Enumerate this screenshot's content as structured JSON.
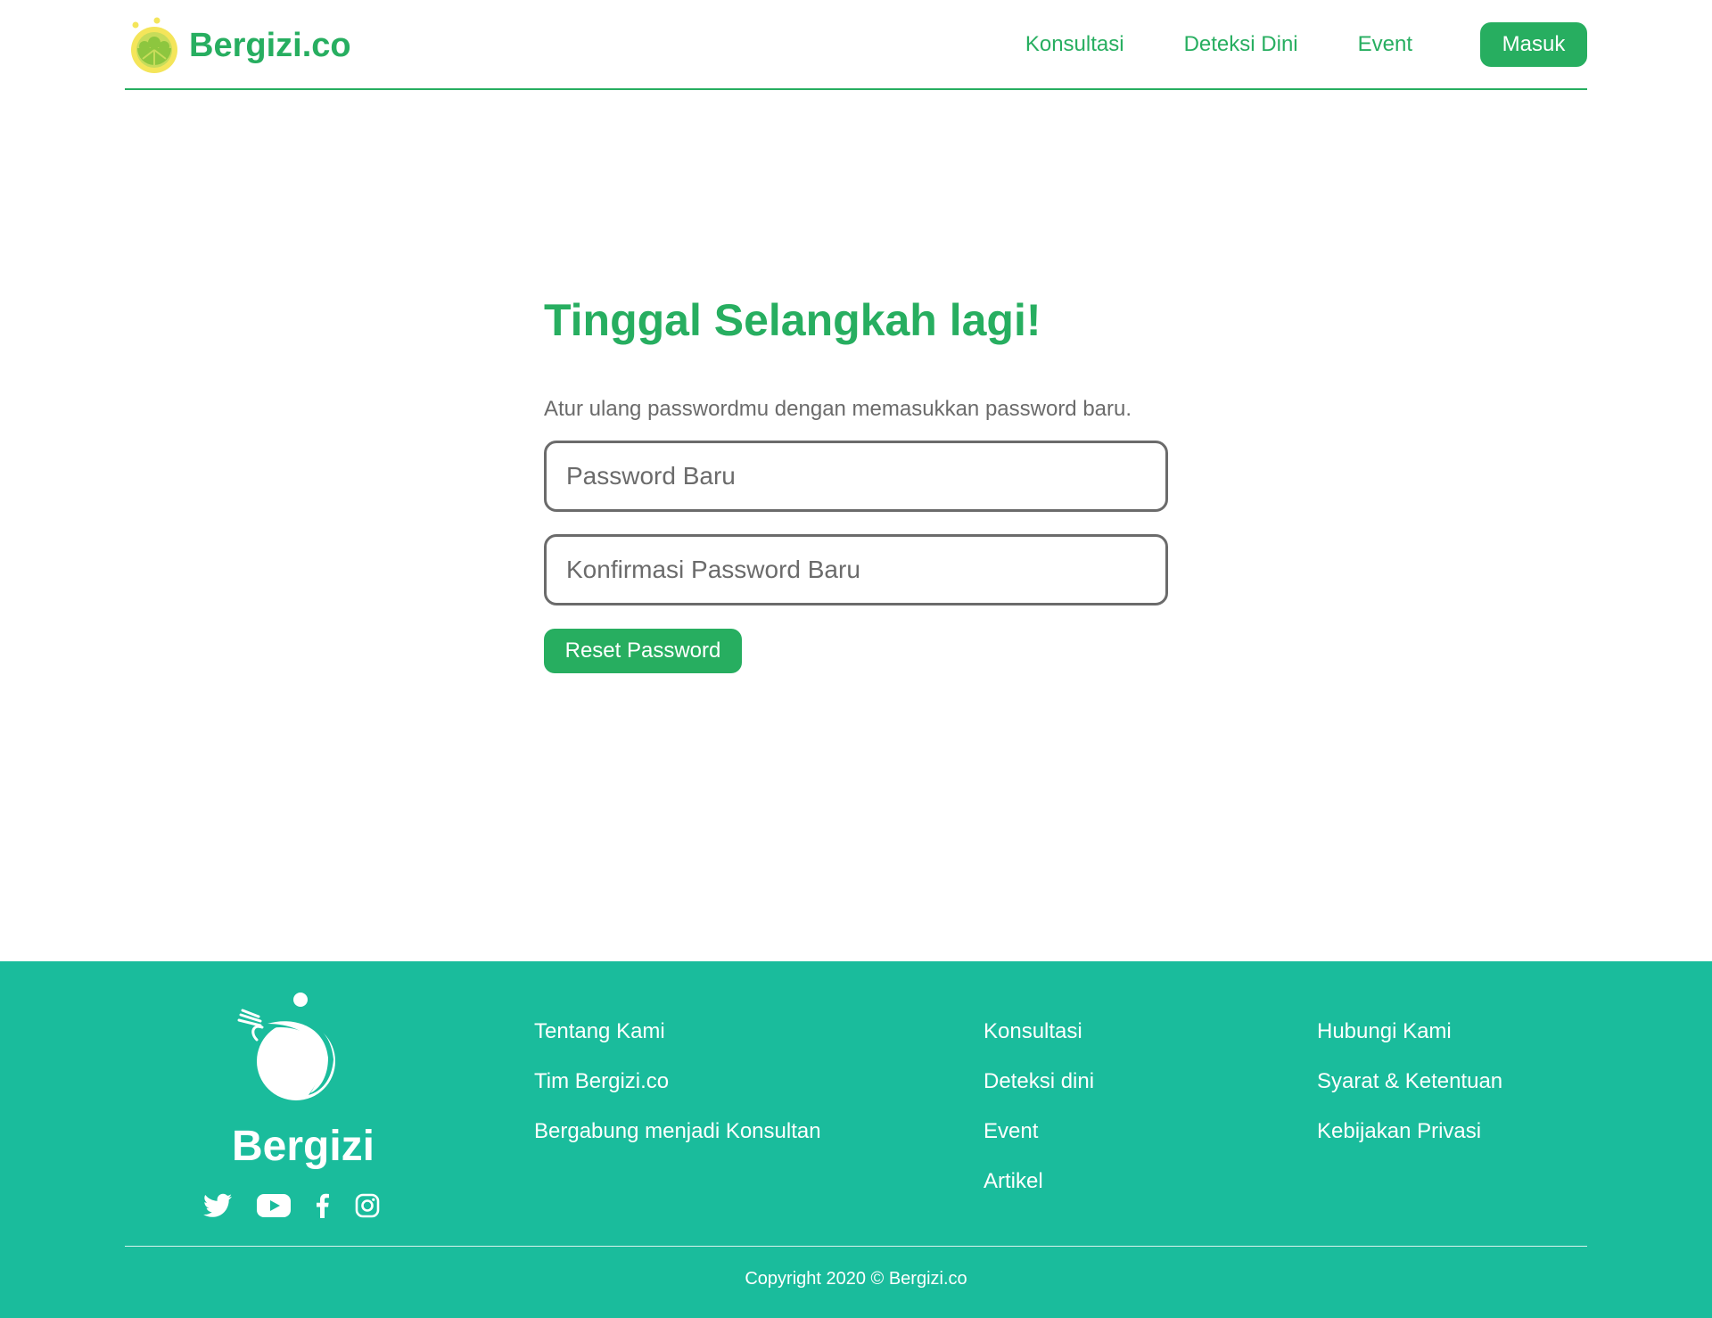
{
  "header": {
    "brand": "Bergizi.co",
    "nav": {
      "konsultasi": "Konsultasi",
      "deteksi": "Deteksi Dini",
      "event": "Event"
    },
    "login_label": "Masuk"
  },
  "main": {
    "title": "Tinggal Selangkah lagi!",
    "subtitle": "Atur ulang passwordmu dengan memasukkan password baru.",
    "new_password_placeholder": "Password Baru",
    "confirm_password_placeholder": "Konfirmasi Password Baru",
    "reset_label": "Reset Password"
  },
  "footer": {
    "brand": "Bergizi",
    "socials": [
      "twitter-icon",
      "youtube-icon",
      "facebook-icon",
      "instagram-icon"
    ],
    "col1": [
      "Tentang Kami",
      "Tim Bergizi.co",
      "Bergabung menjadi Konsultan"
    ],
    "col2": [
      "Konsultasi",
      "Deteksi dini",
      "Event",
      "Artikel"
    ],
    "col3": [
      "Hubungi Kami",
      "Syarat & Ketentuan",
      "Kebijakan Privasi"
    ],
    "copyright": "Copyright 2020 © Bergizi.co"
  },
  "colors": {
    "primary": "#27ae60",
    "footer_bg": "#1abc9c",
    "text_gray": "#6b6b6b"
  }
}
